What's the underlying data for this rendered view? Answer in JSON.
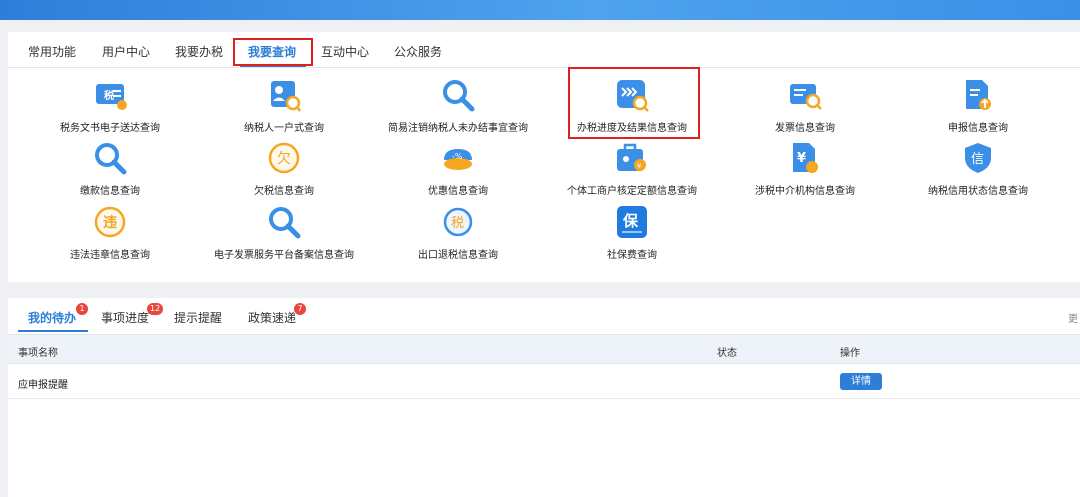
{
  "nav": {
    "tabs": [
      {
        "label": "常用功能"
      },
      {
        "label": "用户中心"
      },
      {
        "label": "我要办税"
      },
      {
        "label": "我要查询"
      },
      {
        "label": "互动中心"
      },
      {
        "label": "公众服务"
      }
    ],
    "active": "我要查询"
  },
  "services": [
    {
      "label": "税务文书电子送达查询",
      "icon": "tax-document-icon"
    },
    {
      "label": "纳税人一户式查询",
      "icon": "taxpayer-profile-icon"
    },
    {
      "label": "简易注销纳税人未办结事宜查询",
      "icon": "search-icon"
    },
    {
      "label": "办税进度及结果信息查询",
      "icon": "progress-search-icon"
    },
    {
      "label": "发票信息查询",
      "icon": "invoice-search-icon"
    },
    {
      "label": "申报信息查询",
      "icon": "declaration-icon"
    },
    {
      "label": "缴款信息查询",
      "icon": "search-icon"
    },
    {
      "label": "欠税信息查询",
      "icon": "arrears-icon"
    },
    {
      "label": "优惠信息查询",
      "icon": "discount-icon"
    },
    {
      "label": "个体工商户核定定额信息查询",
      "icon": "business-search-icon"
    },
    {
      "label": "涉税中介机构信息查询",
      "icon": "agency-icon"
    },
    {
      "label": "纳税信用状态信息查询",
      "icon": "credit-shield-icon"
    },
    {
      "label": "违法违章信息查询",
      "icon": "violation-icon"
    },
    {
      "label": "电子发票服务平台备案信息查询",
      "icon": "search-icon"
    },
    {
      "label": "出口退税信息查询",
      "icon": "export-refund-icon"
    },
    {
      "label": "社保费查询",
      "icon": "social-insurance-icon"
    }
  ],
  "icon_glyphs": {
    "tax": "税",
    "arrears": "欠",
    "yuan": "¥",
    "tax_circle": "税",
    "credit": "信",
    "violation": "违",
    "social": "保"
  },
  "todo": {
    "tabs": [
      {
        "label": "我的待办",
        "badge": "1"
      },
      {
        "label": "事项进度",
        "badge": "12"
      },
      {
        "label": "提示提醒",
        "badge": ""
      },
      {
        "label": "政策速递",
        "badge": "7"
      }
    ],
    "more_label": "更",
    "columns": {
      "name": "事项名称",
      "status": "状态",
      "action": "操作"
    },
    "rows": [
      {
        "name": "应申报提醒",
        "status": "",
        "action": "详情"
      }
    ]
  },
  "colors": {
    "accent": "#2d7ed9",
    "highlight_box": "#e02020",
    "badge": "#e8463e",
    "icon_blue": "#3b8fe6",
    "icon_orange": "#f5a623"
  }
}
